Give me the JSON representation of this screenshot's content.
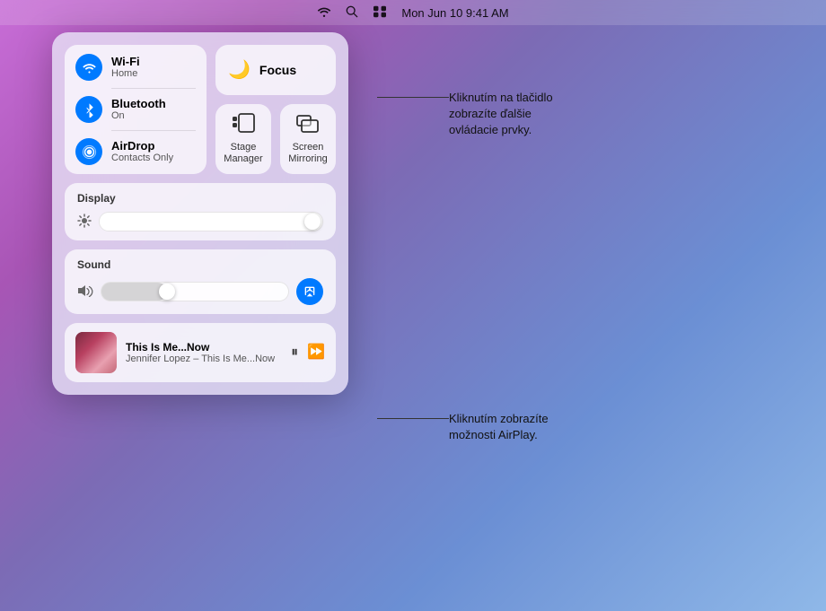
{
  "menubar": {
    "time": "Mon Jun 10  9:41 AM"
  },
  "connectivity": {
    "wifi": {
      "title": "Wi-Fi",
      "subtitle": "Home"
    },
    "bluetooth": {
      "title": "Bluetooth",
      "subtitle": "On"
    },
    "airdrop": {
      "title": "AirDrop",
      "subtitle": "Contacts Only"
    }
  },
  "focus": {
    "label": "Focus"
  },
  "stage_manager": {
    "label": "Stage\nManager"
  },
  "screen_mirroring": {
    "label": "Screen\nMirroring"
  },
  "display": {
    "title": "Display"
  },
  "sound": {
    "title": "Sound"
  },
  "now_playing": {
    "title": "This Is Me...Now",
    "artist": "Jennifer Lopez – This Is Me...Now"
  },
  "annotations": {
    "focus_tip": "Kliknutím na tlačidlo\nzobrazíte ďalšie\novládacie prvky.",
    "airplay_tip": "Kliknutím zobrazíte\nmožnosti AirPlay."
  }
}
